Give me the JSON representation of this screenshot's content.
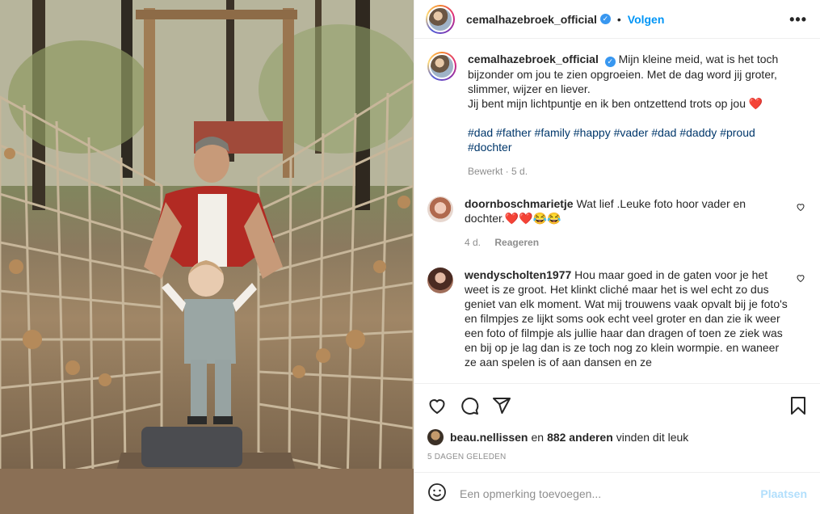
{
  "post": {
    "username": "cemalhazebroek_official",
    "follow_label": "Volgen",
    "dot": "•",
    "more_label": "•••",
    "caption_text": "Mijn kleine meid, wat is het toch bijzonder om jou te zien opgroeien. Met de dag word jij groter, slimmer, wijzer en liever.",
    "caption_line2": "Jij bent mijn lichtpuntje en ik ben ontzettend trots op jou ❤️",
    "hashtags": [
      "#dad",
      "#father",
      "#family",
      "#happy",
      "#vader",
      "#dad",
      "#daddy",
      "#proud",
      "#dochter"
    ],
    "caption_meta": "Bewerkt · 5 d."
  },
  "comments": [
    {
      "username": "doornboschmarietje",
      "text": "Wat lief .Leuke foto hoor vader en dochter.❤️❤️😂😂",
      "age": "4 d.",
      "reply_label": "Reageren"
    },
    {
      "username": "wendyscholten1977",
      "text": "Hou maar goed in de gaten voor je het weet is ze groot. Het klinkt cliché maar het is wel echt zo dus geniet van elk moment. Wat mij trouwens vaak opvalt bij je foto's en filmpjes ze lijkt soms ook echt veel groter en dan zie ik weer een foto of filmpje als jullie haar dan dragen of toen ze ziek was en bij op je lag dan is ze toch nog zo klein wormpie. en waneer ze aan spelen is of aan dansen en ze"
    }
  ],
  "likes": {
    "first_liker": "beau.nellissen",
    "connector": "en",
    "others": "882 anderen",
    "suffix": "vinden dit leuk"
  },
  "date_label": "5 dagen geleden",
  "add_comment": {
    "placeholder": "Een opmerking toevoegen...",
    "post_label": "Plaatsen"
  },
  "icons": {
    "like": "heart-icon",
    "comment": "comment-icon",
    "share": "share-icon",
    "save": "bookmark-icon",
    "emoji": "emoji-icon",
    "more": "more-options-icon",
    "verified": "verified-badge-icon"
  },
  "colors": {
    "link": "#0095f6",
    "hashtag": "#00376b",
    "muted": "#8e8e8e",
    "verified": "#3897f0",
    "post_disabled": "#b2dffc"
  }
}
